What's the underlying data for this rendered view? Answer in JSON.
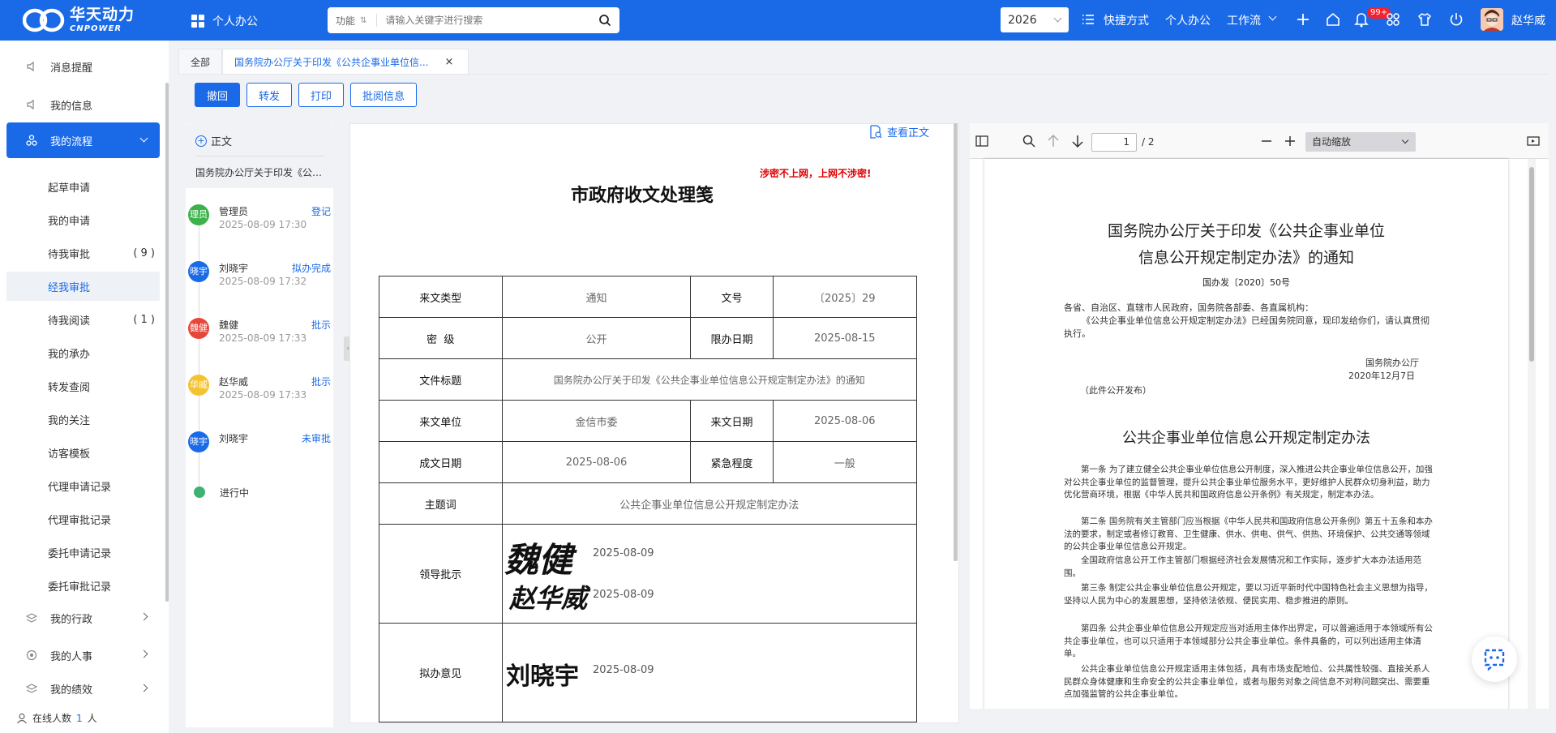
{
  "header": {
    "logo_cn": "华天动力",
    "logo_en": "CNPOWER",
    "app_name": "个人办公",
    "search_func": "功能",
    "search_placeholder": "请输入关键字进行搜索",
    "year": "2026",
    "nav": {
      "shortcut": "快捷方式",
      "personal": "个人办公",
      "workflow": "工作流"
    },
    "badge": "99+",
    "user": "赵华威",
    "accent": "#1a6ae8"
  },
  "sidebar": {
    "items": [
      {
        "label": "消息提醒",
        "icon": "speaker-icon"
      },
      {
        "label": "我的信息",
        "icon": "speaker-icon"
      },
      {
        "label": "我的流程",
        "icon": "flow-icon"
      }
    ],
    "sub": [
      {
        "label": "起草申请",
        "count": ""
      },
      {
        "label": "我的申请",
        "count": ""
      },
      {
        "label": "待我审批",
        "count": "( 9 )"
      },
      {
        "label": "经我审批",
        "count": ""
      },
      {
        "label": "待我阅读",
        "count": "( 1 )"
      },
      {
        "label": "我的承办",
        "count": ""
      },
      {
        "label": "转发查阅",
        "count": ""
      },
      {
        "label": "我的关注",
        "count": ""
      },
      {
        "label": "访客模板",
        "count": ""
      },
      {
        "label": "代理申请记录",
        "count": ""
      },
      {
        "label": "代理审批记录",
        "count": ""
      },
      {
        "label": "委托申请记录",
        "count": ""
      },
      {
        "label": "委托审批记录",
        "count": ""
      }
    ],
    "bottom": [
      {
        "label": "我的行政"
      },
      {
        "label": "我的人事"
      },
      {
        "label": "我的绩效"
      }
    ],
    "online_label": "在线人数",
    "online_count": "1",
    "online_unit": "人"
  },
  "tabs": {
    "all": "全部",
    "doc": "国务院办公厅关于印发《公共企事业单位信...",
    "close": "×"
  },
  "actions": {
    "withdraw": "撤回",
    "forward": "转发",
    "print": "打印",
    "review": "批阅信息"
  },
  "flow": {
    "zhengwen_label": "正文",
    "zhengwen_file": "国务院办公厅关于印发《公共企事业单位信息公开规定制定办法》的通知",
    "nodes": [
      {
        "avatar": "理员",
        "name": "管理员",
        "time": "2025-08-09 17:30",
        "status": "登记",
        "color": "#3cb34a"
      },
      {
        "avatar": "晓宇",
        "name": "刘晓宇",
        "time": "2025-08-09 17:32",
        "status": "拟办完成",
        "color": "#1a6ae8"
      },
      {
        "avatar": "魏健",
        "name": "魏健",
        "time": "2025-08-09 17:33",
        "status": "批示",
        "color": "#e8463a"
      },
      {
        "avatar": "华威",
        "name": "赵华威",
        "time": "2025-08-09 17:33",
        "status": "批示",
        "color": "#f5c330"
      },
      {
        "avatar": "晓宇",
        "name": "刘晓宇",
        "time": "",
        "status": "未审批",
        "color": "#1a6ae8"
      }
    ],
    "in_progress": "进行中"
  },
  "doc": {
    "view_link": "查看正文",
    "secret": "涉密不上网，上网不涉密!",
    "title": "市政府收文处理笺",
    "rows": {
      "type_label": "来文类型",
      "type_value": "通知",
      "no_label": "文号",
      "no_value": "〔2025〕29",
      "secret_label": "密  级",
      "secret_value": "公开",
      "deadline_label": "限办日期",
      "deadline_value": "2025-08-15",
      "file_title_label": "文件标题",
      "file_title_value": "国务院办公厅关于印发《公共企事业单位信息公开规定制定办法》的通知",
      "unit_label": "来文单位",
      "unit_value": "金信市委",
      "date_label": "来文日期",
      "date_value": "2025-08-06",
      "made_label": "成文日期",
      "made_value": "2025-08-06",
      "urgency_label": "紧急程度",
      "urgency_value": "一般",
      "subject_label": "主题词",
      "subject_value": "公共企事业单位信息公开规定制定办法",
      "leader_label": "领导批示",
      "opinion_label": "拟办意见"
    },
    "sign1_name": "魏健",
    "sign1_date": "2025-08-09",
    "sign2_name": "赵华威",
    "sign2_date": "2025-08-09",
    "sign3_name": "刘晓宇",
    "sign3_date": "2025-08-09"
  },
  "pdf": {
    "page": "1",
    "total": "/ 2",
    "zoom": "自动缩放",
    "title1": "国务院办公厅关于印发《公共企事业单位",
    "title2": "信息公开规定制定办法》的通知",
    "docno": "国办发〔2020〕50号",
    "greet": "各省、自治区、直辖市人民政府，国务院各部委、各直属机构：",
    "intro": "《公共企事业单位信息公开规定制定办法》已经国务院同意，现印发给你们，请认真贯彻执行。",
    "sign_office": "国务院办公厅",
    "sign_date": "2020年12月7日",
    "public": "（此件公开发布）",
    "h2": "公共企事业单位信息公开规定制定办法",
    "a1": "第一条  为了建立健全公共企事业单位信息公开制度，深入推进公共企事业单位信息公开，加强对公共企事业单位的监督管理，提升公共企事业单位服务水平，更好维护人民群众切身利益，助力优化营商环境，根据《中华人民共和国政府信息公开条例》有关规定，制定本办法。",
    "a2": "第二条  国务院有关主管部门应当根据《中华人民共和国政府信息公开条例》第五十五条和本办法的要求，制定或者修订教育、卫生健康、供水、供电、供气、供热、环境保护、公共交通等领域的公共企事业单位信息公开规定。",
    "a2b": "全国政府信息公开工作主管部门根据经济社会发展情况和工作实际，逐步扩大本办法适用范围。",
    "a3": "第三条  制定公共企事业单位信息公开规定，要以习近平新时代中国特色社会主义思想为指导，坚持以人民为中心的发展思想，坚持依法依规、便民实用、稳步推进的原则。",
    "a4": "第四条  公共企事业单位信息公开规定应当对适用主体作出界定，可以普遍适用于本领域所有公共企事业单位，也可以只适用于本领域部分公共企事业单位。条件具备的，可以列出适用主体清单。",
    "a4b": "公共企事业单位信息公开规定适用主体包括，具有市场支配地位、公共属性较强、直接关系人民群众身体健康和生命安全的公共企事业单位，或者与服务对象之间信息不对称问题突出、需要重点加强监管的公共企事业单位。"
  }
}
